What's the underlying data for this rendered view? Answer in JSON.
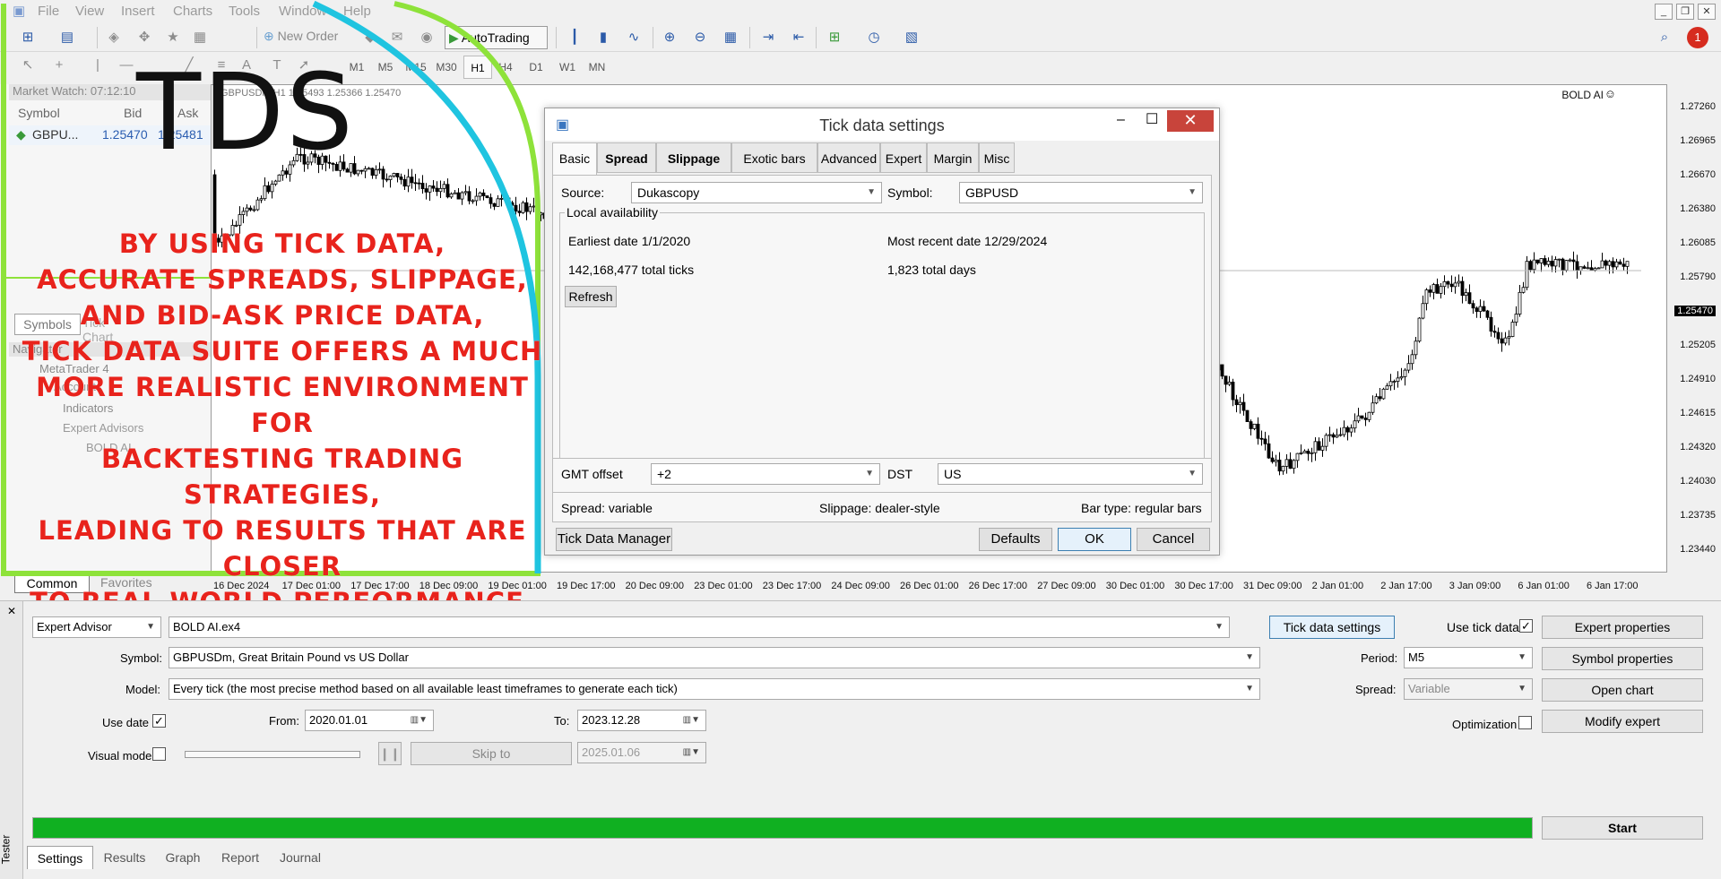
{
  "menu": [
    "File",
    "View",
    "Insert",
    "Charts",
    "Tools",
    "Window",
    "Help"
  ],
  "toolbar": {
    "new_order": "New Order",
    "autotrading": "AutoTrading",
    "timeframes": [
      "M1",
      "M5",
      "M15",
      "M30",
      "H1",
      "H4",
      "D1",
      "W1",
      "MN"
    ],
    "active_tf": "H1",
    "notifications": "1"
  },
  "market_watch": {
    "title": "Market Watch: 07:12:10",
    "headers": [
      "Symbol",
      "Bid",
      "Ask"
    ],
    "row": {
      "symbol": "GBPU...",
      "bid": "1.25470",
      "ask": "1.25481"
    },
    "tabs": [
      "Symbols",
      "Tick Chart"
    ]
  },
  "navigator": {
    "title": "Navigator",
    "items": [
      "MetaTrader 4",
      "Accounts",
      "Indicators",
      "Expert Advisors",
      "BOLD AI"
    ],
    "tabs": [
      "Common",
      "Favorites"
    ]
  },
  "chart": {
    "header": "GBPUSDm,H1  1.25493 1.25366 1.25470",
    "ea_label": "BOLD AI",
    "current_price": "1.25470",
    "price_labels": [
      "1.27260",
      "1.26965",
      "1.26670",
      "1.26380",
      "1.26085",
      "1.25790",
      "1.25470",
      "1.25205",
      "1.24910",
      "1.24615",
      "1.24320",
      "1.24030",
      "1.23735",
      "1.23440"
    ],
    "date_labels": [
      "16 Dec 2024",
      "17 Dec 01:00",
      "17 Dec 17:00",
      "18 Dec 09:00",
      "19 Dec 01:00",
      "19 Dec 17:00",
      "20 Dec 09:00",
      "23 Dec 01:00",
      "23 Dec 17:00",
      "24 Dec 09:00",
      "26 Dec 01:00",
      "26 Dec 17:00",
      "27 Dec 09:00",
      "30 Dec 01:00",
      "30 Dec 17:00",
      "31 Dec 09:00",
      "2 Jan 01:00",
      "2 Jan 17:00",
      "3 Jan 09:00",
      "6 Jan 01:00",
      "6 Jan 17:00"
    ]
  },
  "overlay": {
    "title": "TDS",
    "promo": [
      "By using tick data,",
      "accurate spreads, slippage,",
      "and bid-ask price data,",
      "Tick Data Suite offers a much",
      "more realistic environment for",
      "backtesting trading strategies,",
      "leading to results that are closer",
      "to real-world performance."
    ],
    "colors": {
      "green": "#8ee23a",
      "cyan": "#1fc4e0",
      "red": "#e8231c"
    }
  },
  "dialog": {
    "title": "Tick data settings",
    "tabs": [
      "Basic",
      "Spread",
      "Slippage",
      "Exotic bars",
      "Advanced",
      "Expert",
      "Margin",
      "Misc"
    ],
    "source_label": "Source:",
    "source_value": "Dukascopy",
    "symbol_label": "Symbol:",
    "symbol_value": "GBPUSD",
    "local_avail": "Local availability",
    "earliest": "Earliest date 1/1/2020",
    "recent": "Most recent date 12/29/2024",
    "ticks": "142,168,477 total ticks",
    "days": "1,823 total days",
    "refresh": "Refresh",
    "gmt_label": "GMT offset",
    "gmt_value": "+2",
    "dst_label": "DST",
    "dst_value": "US",
    "spread": "Spread: variable",
    "slippage": "Slippage: dealer-style",
    "bartype": "Bar type: regular bars",
    "manager": "Tick Data Manager",
    "defaults": "Defaults",
    "ok": "OK",
    "cancel": "Cancel"
  },
  "tester": {
    "side_label": "Tester",
    "type": "Expert Advisor",
    "ea_file": "BOLD AI.ex4",
    "tick_settings": "Tick data settings",
    "use_tick": "Use tick data",
    "expert_props": "Expert properties",
    "symbol_label": "Symbol:",
    "symbol_value": "GBPUSDm, Great Britain Pound vs US Dollar",
    "period_label": "Period:",
    "period_value": "M5",
    "symbol_props": "Symbol properties",
    "model_label": "Model:",
    "model_value": "Every tick (the most precise method based on all available least timeframes to generate each tick)",
    "spread_label": "Spread:",
    "spread_value": "Variable",
    "open_chart": "Open chart",
    "use_date": "Use date",
    "from_label": "From:",
    "from_value": "2020.01.01",
    "to_label": "To:",
    "to_value": "2023.12.28",
    "optimization": "Optimization",
    "modify": "Modify expert",
    "visual_mode": "Visual mode",
    "skip_to": "Skip to",
    "skip_date": "2025.01.06",
    "progress": 1.0,
    "start": "Start",
    "tabs": [
      "Settings",
      "Results",
      "Graph",
      "Report",
      "Journal"
    ]
  }
}
